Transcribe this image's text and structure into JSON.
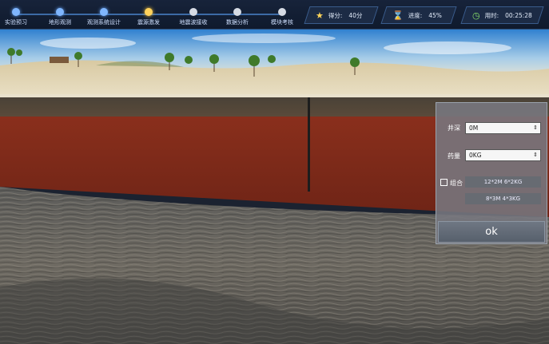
{
  "steps": [
    {
      "label": "实验预习",
      "state": "done"
    },
    {
      "label": "地形观测",
      "state": "done"
    },
    {
      "label": "观测系统设计",
      "state": "done"
    },
    {
      "label": "震源激发",
      "state": "active"
    },
    {
      "label": "地震波接收",
      "state": "pending"
    },
    {
      "label": "数据分析",
      "state": "pending"
    },
    {
      "label": "模块考核",
      "state": "pending"
    }
  ],
  "stats": {
    "score_label": "得分:",
    "score_value": "40分",
    "progress_label": "进度:",
    "progress_value": "45%",
    "time_label": "用时:",
    "time_value": "00:25:28"
  },
  "panel": {
    "depth_label": "井深",
    "depth_value": "0M",
    "dose_label": "药量",
    "dose_value": "0KG",
    "combo_label": "组合",
    "combo_checked": false,
    "combo_option_1": "12*2M 6*2KG",
    "combo_option_2": "8*3M 4*3KG",
    "ok_label": "ok"
  },
  "icons": {
    "score": "medal-icon",
    "progress": "hourglass-icon",
    "time": "clock-icon"
  },
  "colors": {
    "accent": "#3c6aa5",
    "active_step": "#ffd25c",
    "panel_bg": "#78787f"
  }
}
